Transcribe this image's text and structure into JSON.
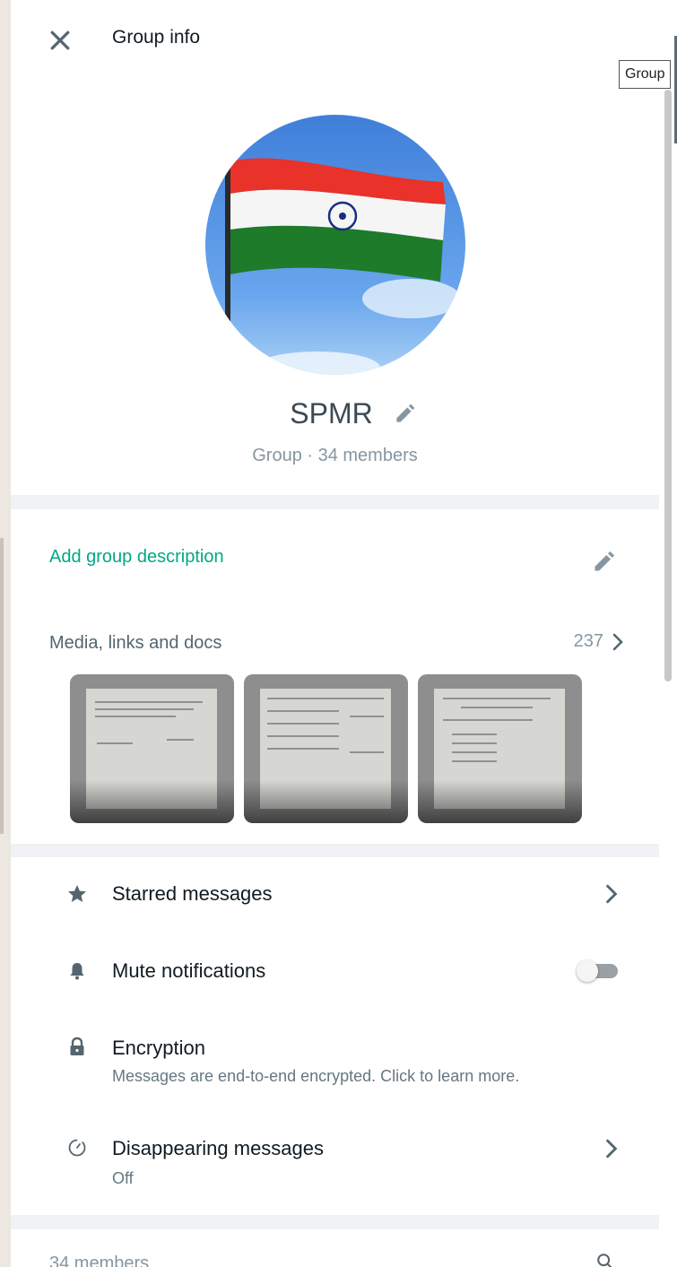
{
  "header": {
    "title": "Group info",
    "close_icon": "close-icon"
  },
  "tooltip": {
    "text": "Group"
  },
  "group": {
    "name": "SPMR",
    "subtitle": "Group · 34 members",
    "avatar": "indian-flag-avatar"
  },
  "description": {
    "add_label": "Add group description",
    "accent_color": "#00a884"
  },
  "media": {
    "label": "Media, links and docs",
    "count": "237",
    "thumbnails": [
      "document-photo-1",
      "document-photo-2",
      "document-photo-3"
    ]
  },
  "options": [
    {
      "label": "Starred messages",
      "icon": "star-icon"
    },
    {
      "label": "Mute notifications",
      "icon": "bell-icon",
      "toggle_on": false
    },
    {
      "label": "Encryption",
      "sub": "Messages are end-to-end encrypted. Click to learn more.",
      "icon": "lock-icon"
    },
    {
      "label": "Disappearing messages",
      "sub": "Off",
      "icon": "timer-icon"
    }
  ],
  "members": {
    "label": "34 members",
    "icon": "search-icon"
  }
}
